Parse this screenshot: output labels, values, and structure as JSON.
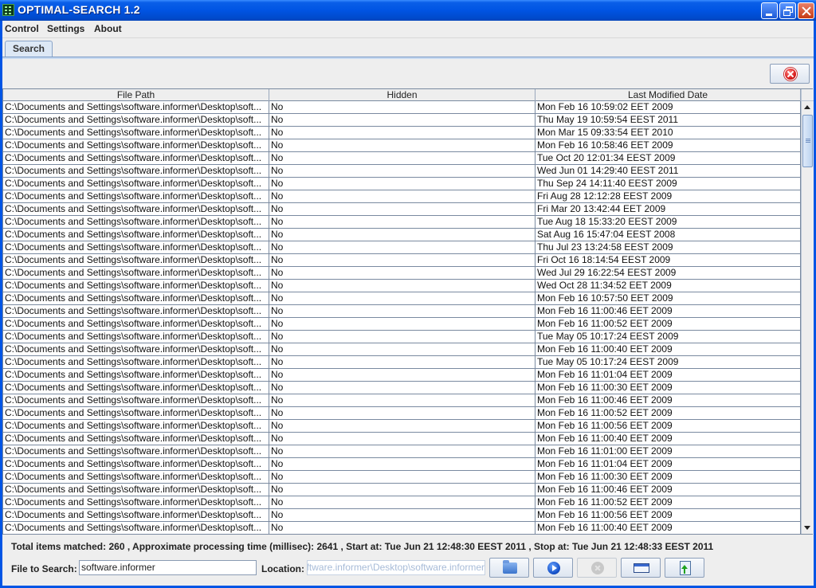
{
  "window": {
    "title": "OPTIMAL-SEARCH 1.2",
    "controls": [
      "minimize",
      "restore",
      "close"
    ]
  },
  "menubar": {
    "items": [
      {
        "label": "Control"
      },
      {
        "label": "Settings"
      },
      {
        "label": "About"
      }
    ]
  },
  "tabs": [
    {
      "label": "Search",
      "selected": true
    }
  ],
  "toolbar": {
    "clear_icon": "red-x-circle-icon"
  },
  "table": {
    "columns": [
      "File Path",
      "Hidden",
      "Last Modified Date"
    ],
    "rows": [
      {
        "path": "C:\\Documents and Settings\\software.informer\\Desktop\\soft...",
        "hidden": "No",
        "modified": "Mon Feb 16 10:59:02 EET 2009"
      },
      {
        "path": "C:\\Documents and Settings\\software.informer\\Desktop\\soft...",
        "hidden": "No",
        "modified": "Thu May 19 10:59:54 EEST 2011"
      },
      {
        "path": "C:\\Documents and Settings\\software.informer\\Desktop\\soft...",
        "hidden": "No",
        "modified": "Mon Mar 15 09:33:54 EET 2010"
      },
      {
        "path": "C:\\Documents and Settings\\software.informer\\Desktop\\soft...",
        "hidden": "No",
        "modified": "Mon Feb 16 10:58:46 EET 2009"
      },
      {
        "path": "C:\\Documents and Settings\\software.informer\\Desktop\\soft...",
        "hidden": "No",
        "modified": "Tue Oct 20 12:01:34 EEST 2009"
      },
      {
        "path": "C:\\Documents and Settings\\software.informer\\Desktop\\soft...",
        "hidden": "No",
        "modified": "Wed Jun 01 14:29:40 EEST 2011"
      },
      {
        "path": "C:\\Documents and Settings\\software.informer\\Desktop\\soft...",
        "hidden": "No",
        "modified": "Thu Sep 24 14:11:40 EEST 2009"
      },
      {
        "path": "C:\\Documents and Settings\\software.informer\\Desktop\\soft...",
        "hidden": "No",
        "modified": "Fri Aug 28 12:12:28 EEST 2009"
      },
      {
        "path": "C:\\Documents and Settings\\software.informer\\Desktop\\soft...",
        "hidden": "No",
        "modified": "Fri Mar 20 13:42:44 EET 2009"
      },
      {
        "path": "C:\\Documents and Settings\\software.informer\\Desktop\\soft...",
        "hidden": "No",
        "modified": "Tue Aug 18 15:33:20 EEST 2009"
      },
      {
        "path": "C:\\Documents and Settings\\software.informer\\Desktop\\soft...",
        "hidden": "No",
        "modified": "Sat Aug 16 15:47:04 EEST 2008"
      },
      {
        "path": "C:\\Documents and Settings\\software.informer\\Desktop\\soft...",
        "hidden": "No",
        "modified": "Thu Jul 23 13:24:58 EEST 2009"
      },
      {
        "path": "C:\\Documents and Settings\\software.informer\\Desktop\\soft...",
        "hidden": "No",
        "modified": "Fri Oct 16 18:14:54 EEST 2009"
      },
      {
        "path": "C:\\Documents and Settings\\software.informer\\Desktop\\soft...",
        "hidden": "No",
        "modified": "Wed Jul 29 16:22:54 EEST 2009"
      },
      {
        "path": "C:\\Documents and Settings\\software.informer\\Desktop\\soft...",
        "hidden": "No",
        "modified": "Wed Oct 28 11:34:52 EET 2009"
      },
      {
        "path": "C:\\Documents and Settings\\software.informer\\Desktop\\soft...",
        "hidden": "No",
        "modified": "Mon Feb 16 10:57:50 EET 2009"
      },
      {
        "path": "C:\\Documents and Settings\\software.informer\\Desktop\\soft...",
        "hidden": "No",
        "modified": "Mon Feb 16 11:00:46 EET 2009"
      },
      {
        "path": "C:\\Documents and Settings\\software.informer\\Desktop\\soft...",
        "hidden": "No",
        "modified": "Mon Feb 16 11:00:52 EET 2009"
      },
      {
        "path": "C:\\Documents and Settings\\software.informer\\Desktop\\soft...",
        "hidden": "No",
        "modified": "Tue May 05 10:17:24 EEST 2009"
      },
      {
        "path": "C:\\Documents and Settings\\software.informer\\Desktop\\soft...",
        "hidden": "No",
        "modified": "Mon Feb 16 11:00:40 EET 2009"
      },
      {
        "path": "C:\\Documents and Settings\\software.informer\\Desktop\\soft...",
        "hidden": "No",
        "modified": "Tue May 05 10:17:24 EEST 2009"
      },
      {
        "path": "C:\\Documents and Settings\\software.informer\\Desktop\\soft...",
        "hidden": "No",
        "modified": "Mon Feb 16 11:01:04 EET 2009"
      },
      {
        "path": "C:\\Documents and Settings\\software.informer\\Desktop\\soft...",
        "hidden": "No",
        "modified": "Mon Feb 16 11:00:30 EET 2009"
      },
      {
        "path": "C:\\Documents and Settings\\software.informer\\Desktop\\soft...",
        "hidden": "No",
        "modified": "Mon Feb 16 11:00:46 EET 2009"
      },
      {
        "path": "C:\\Documents and Settings\\software.informer\\Desktop\\soft...",
        "hidden": "No",
        "modified": "Mon Feb 16 11:00:52 EET 2009"
      },
      {
        "path": "C:\\Documents and Settings\\software.informer\\Desktop\\soft...",
        "hidden": "No",
        "modified": "Mon Feb 16 11:00:56 EET 2009"
      },
      {
        "path": "C:\\Documents and Settings\\software.informer\\Desktop\\soft...",
        "hidden": "No",
        "modified": "Mon Feb 16 11:00:40 EET 2009"
      },
      {
        "path": "C:\\Documents and Settings\\software.informer\\Desktop\\soft...",
        "hidden": "No",
        "modified": "Mon Feb 16 11:01:00 EET 2009"
      },
      {
        "path": "C:\\Documents and Settings\\software.informer\\Desktop\\soft...",
        "hidden": "No",
        "modified": "Mon Feb 16 11:01:04 EET 2009"
      },
      {
        "path": "C:\\Documents and Settings\\software.informer\\Desktop\\soft...",
        "hidden": "No",
        "modified": "Mon Feb 16 11:00:30 EET 2009"
      },
      {
        "path": "C:\\Documents and Settings\\software.informer\\Desktop\\soft...",
        "hidden": "No",
        "modified": "Mon Feb 16 11:00:46 EET 2009"
      },
      {
        "path": "C:\\Documents and Settings\\software.informer\\Desktop\\soft...",
        "hidden": "No",
        "modified": "Mon Feb 16 11:00:52 EET 2009"
      },
      {
        "path": "C:\\Documents and Settings\\software.informer\\Desktop\\soft...",
        "hidden": "No",
        "modified": "Mon Feb 16 11:00:56 EET 2009"
      },
      {
        "path": "C:\\Documents and Settings\\software.informer\\Desktop\\soft...",
        "hidden": "No",
        "modified": "Mon Feb 16 11:00:40 EET 2009"
      }
    ]
  },
  "status": {
    "text": "Total items matched: 260 , Approximate processing time (millisec): 2641 , Start at: Tue Jun 21 12:48:30 EEST 2011 , Stop at: Tue Jun 21 12:48:33 EEST 2011",
    "total_items": 260,
    "processing_ms": 2641,
    "start_at": "Tue Jun 21 12:48:30 EEST 2011",
    "stop_at": "Tue Jun 21 12:48:33 EEST 2011"
  },
  "search": {
    "file_label": "File to Search:",
    "file_value": "software.informer",
    "location_label": "Location:",
    "location_value": "C:\\Documents and Settings\\software.informer\\Desktop\\software.informer",
    "location_enabled": false
  },
  "buttons": [
    {
      "name": "browse-location-button",
      "icon": "folder-icon",
      "enabled": true
    },
    {
      "name": "start-search-button",
      "icon": "play-icon",
      "enabled": true
    },
    {
      "name": "stop-search-button",
      "icon": "stop-icon",
      "enabled": false
    },
    {
      "name": "view-window-button",
      "icon": "window-icon",
      "enabled": true
    },
    {
      "name": "export-button",
      "icon": "export-icon",
      "enabled": true
    }
  ],
  "colors": {
    "titlebar": "#0054e3",
    "selection_accent": "#7a9ac6",
    "grid": "#7a8aa0"
  }
}
